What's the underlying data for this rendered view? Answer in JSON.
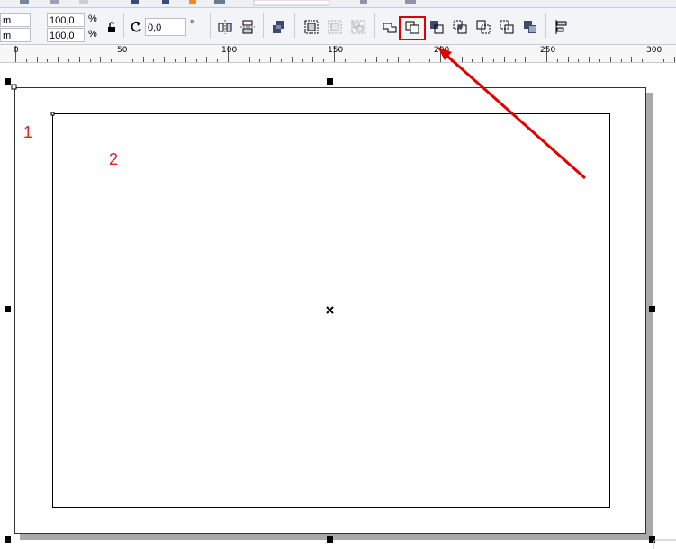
{
  "toolbar": {
    "width_unit_fragment": "m",
    "height_unit_fragment": "m",
    "scale_x": "100,0",
    "scale_y": "100,0",
    "percent_symbol": "%",
    "rotation_value": "0,0",
    "degree_symbol": "°"
  },
  "ruler": {
    "labels": [
      "0",
      "50",
      "100",
      "150",
      "200",
      "250",
      "300"
    ]
  },
  "annotations": {
    "marker_1": "1",
    "marker_2": "2",
    "highlight_color": "#e00000",
    "arrow_color": "#e00000",
    "highlighted_button": "back-minus-front-icon"
  }
}
